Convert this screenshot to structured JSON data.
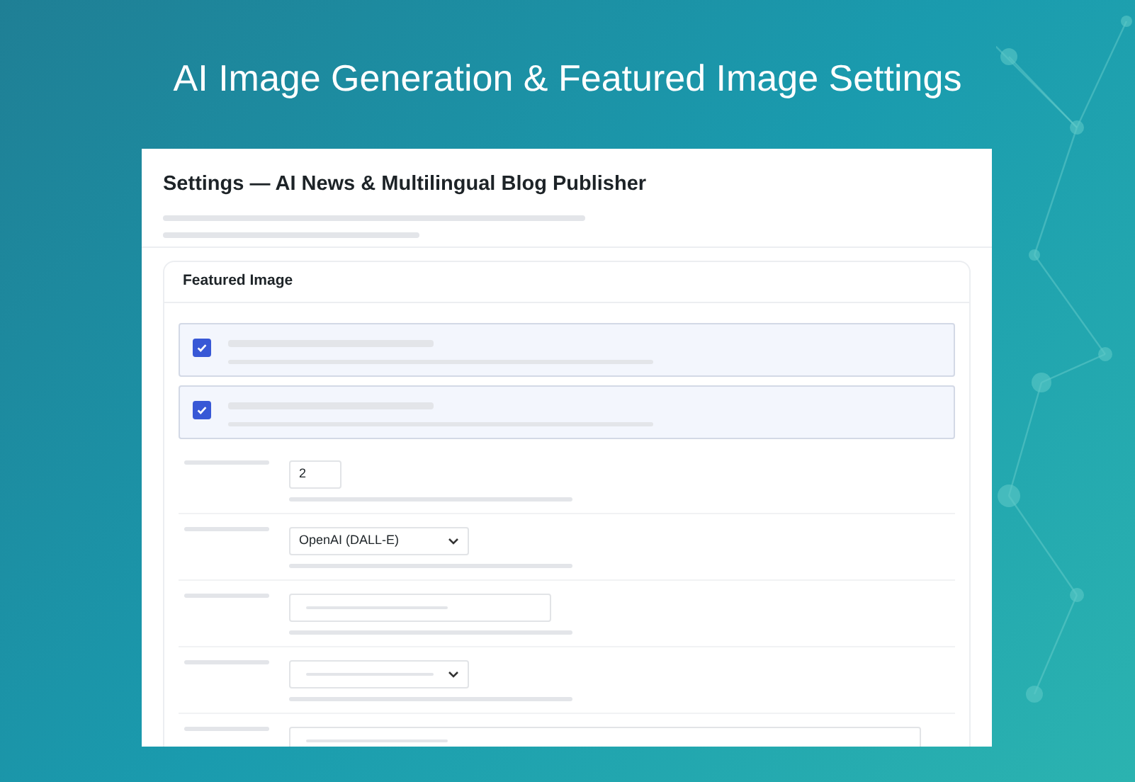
{
  "headline": "AI Image Generation & Featured Image Settings",
  "panel": {
    "title": "Settings — AI News & Multilingual Blog Publisher"
  },
  "section": {
    "title": "Featured Image",
    "toggles": [
      {
        "checked": true
      },
      {
        "checked": true
      }
    ],
    "fields": [
      {
        "kind": "number",
        "value": "2"
      },
      {
        "kind": "select",
        "value": "OpenAI (DALL-E)"
      },
      {
        "kind": "text"
      },
      {
        "kind": "select"
      },
      {
        "kind": "textarea"
      }
    ]
  }
}
